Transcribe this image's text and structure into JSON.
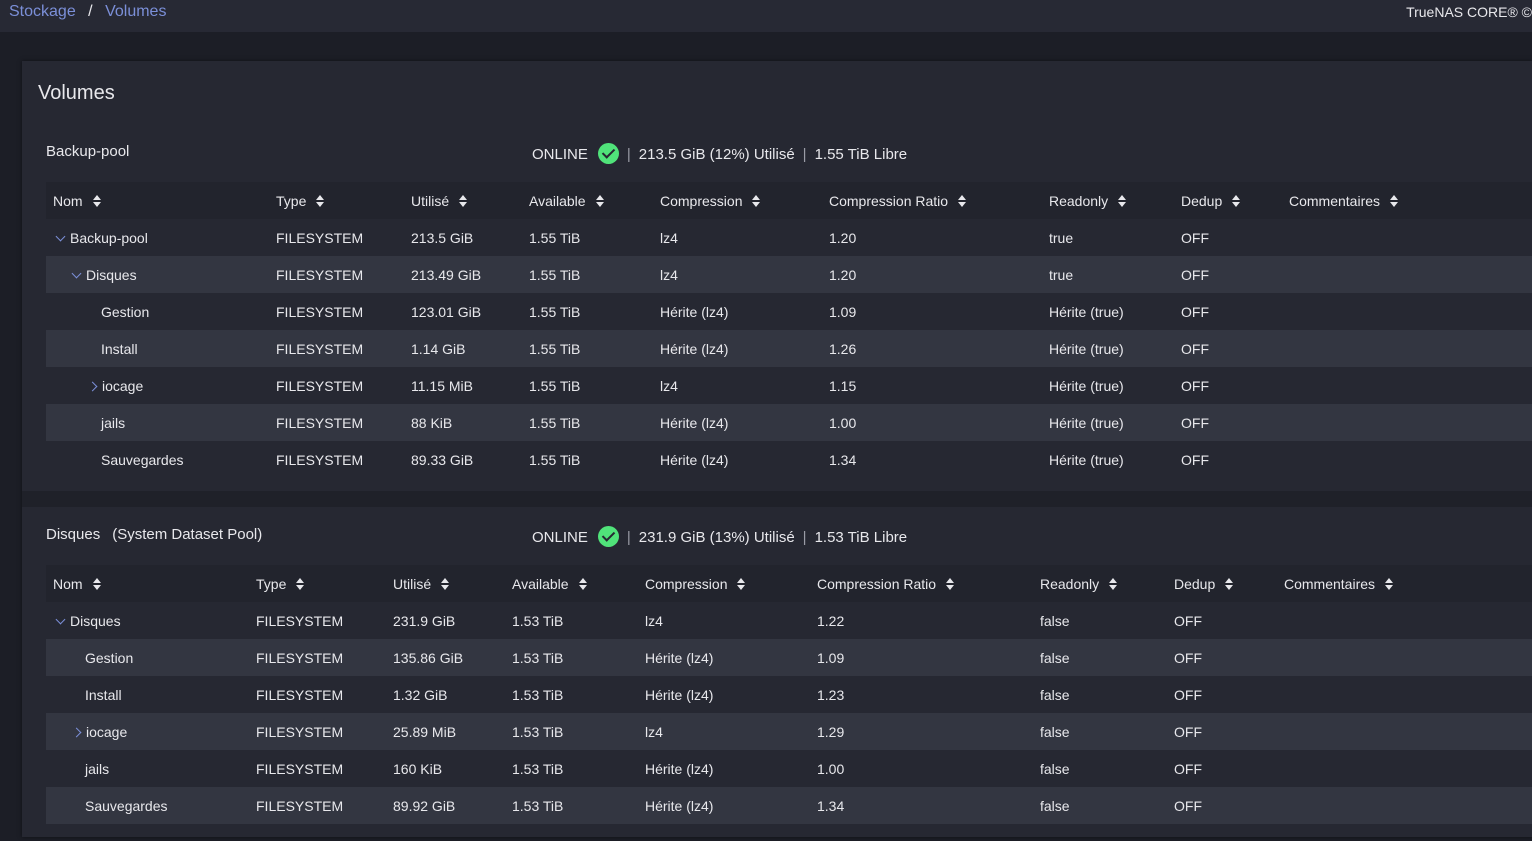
{
  "breadcrumb": {
    "items": [
      "Stockage",
      "Volumes"
    ],
    "separator": "/"
  },
  "brand": "TrueNAS CORE® ©",
  "card_title": "Volumes",
  "columns": [
    "Nom",
    "Type",
    "Utilisé",
    "Available",
    "Compression",
    "Compression Ratio",
    "Readonly",
    "Dedup",
    "Commentaires"
  ],
  "pools": [
    {
      "name": "Backup-pool",
      "subtitle": "",
      "status": "ONLINE",
      "used": "213.5 GiB (12%) Utilisé",
      "free": "1.55 TiB Libre",
      "rows": [
        {
          "name": "Backup-pool",
          "indent": 0,
          "expander": "down",
          "type": "FILESYSTEM",
          "used": "213.5 GiB",
          "available": "1.55 TiB",
          "compression": "lz4",
          "ratio": "1.20",
          "readonly": "true",
          "dedup": "OFF",
          "comments": ""
        },
        {
          "name": "Disques",
          "indent": 1,
          "expander": "down",
          "type": "FILESYSTEM",
          "used": "213.49 GiB",
          "available": "1.55 TiB",
          "compression": "lz4",
          "ratio": "1.20",
          "readonly": "true",
          "dedup": "OFF",
          "comments": ""
        },
        {
          "name": "Gestion",
          "indent": 2,
          "expander": "",
          "type": "FILESYSTEM",
          "used": "123.01 GiB",
          "available": "1.55 TiB",
          "compression": "Hérite (lz4)",
          "ratio": "1.09",
          "readonly": "Hérite (true)",
          "dedup": "OFF",
          "comments": ""
        },
        {
          "name": "Install",
          "indent": 2,
          "expander": "",
          "type": "FILESYSTEM",
          "used": "1.14 GiB",
          "available": "1.55 TiB",
          "compression": "Hérite (lz4)",
          "ratio": "1.26",
          "readonly": "Hérite (true)",
          "dedup": "OFF",
          "comments": ""
        },
        {
          "name": "iocage",
          "indent": 2,
          "expander": "right",
          "type": "FILESYSTEM",
          "used": "11.15 MiB",
          "available": "1.55 TiB",
          "compression": "lz4",
          "ratio": "1.15",
          "readonly": "Hérite (true)",
          "dedup": "OFF",
          "comments": ""
        },
        {
          "name": "jails",
          "indent": 2,
          "expander": "",
          "type": "FILESYSTEM",
          "used": "88 KiB",
          "available": "1.55 TiB",
          "compression": "Hérite (lz4)",
          "ratio": "1.00",
          "readonly": "Hérite (true)",
          "dedup": "OFF",
          "comments": ""
        },
        {
          "name": "Sauvegardes",
          "indent": 2,
          "expander": "",
          "type": "FILESYSTEM",
          "used": "89.33 GiB",
          "available": "1.55 TiB",
          "compression": "Hérite (lz4)",
          "ratio": "1.34",
          "readonly": "Hérite (true)",
          "dedup": "OFF",
          "comments": ""
        }
      ]
    },
    {
      "name": "Disques",
      "subtitle": "(System Dataset Pool)",
      "status": "ONLINE",
      "used": "231.9 GiB (13%) Utilisé",
      "free": "1.53 TiB Libre",
      "rows": [
        {
          "name": "Disques",
          "indent": 0,
          "expander": "down",
          "type": "FILESYSTEM",
          "used": "231.9 GiB",
          "available": "1.53 TiB",
          "compression": "lz4",
          "ratio": "1.22",
          "readonly": "false",
          "dedup": "OFF",
          "comments": ""
        },
        {
          "name": "Gestion",
          "indent": 1,
          "expander": "",
          "type": "FILESYSTEM",
          "used": "135.86 GiB",
          "available": "1.53 TiB",
          "compression": "Hérite (lz4)",
          "ratio": "1.09",
          "readonly": "false",
          "dedup": "OFF",
          "comments": ""
        },
        {
          "name": "Install",
          "indent": 1,
          "expander": "",
          "type": "FILESYSTEM",
          "used": "1.32 GiB",
          "available": "1.53 TiB",
          "compression": "Hérite (lz4)",
          "ratio": "1.23",
          "readonly": "false",
          "dedup": "OFF",
          "comments": ""
        },
        {
          "name": "iocage",
          "indent": 1,
          "expander": "right",
          "type": "FILESYSTEM",
          "used": "25.89 MiB",
          "available": "1.53 TiB",
          "compression": "lz4",
          "ratio": "1.29",
          "readonly": "false",
          "dedup": "OFF",
          "comments": ""
        },
        {
          "name": "jails",
          "indent": 1,
          "expander": "",
          "type": "FILESYSTEM",
          "used": "160 KiB",
          "available": "1.53 TiB",
          "compression": "Hérite (lz4)",
          "ratio": "1.00",
          "readonly": "false",
          "dedup": "OFF",
          "comments": ""
        },
        {
          "name": "Sauvegardes",
          "indent": 1,
          "expander": "",
          "type": "FILESYSTEM",
          "used": "89.92 GiB",
          "available": "1.53 TiB",
          "compression": "Hérite (lz4)",
          "ratio": "1.34",
          "readonly": "false",
          "dedup": "OFF",
          "comments": ""
        }
      ]
    }
  ]
}
